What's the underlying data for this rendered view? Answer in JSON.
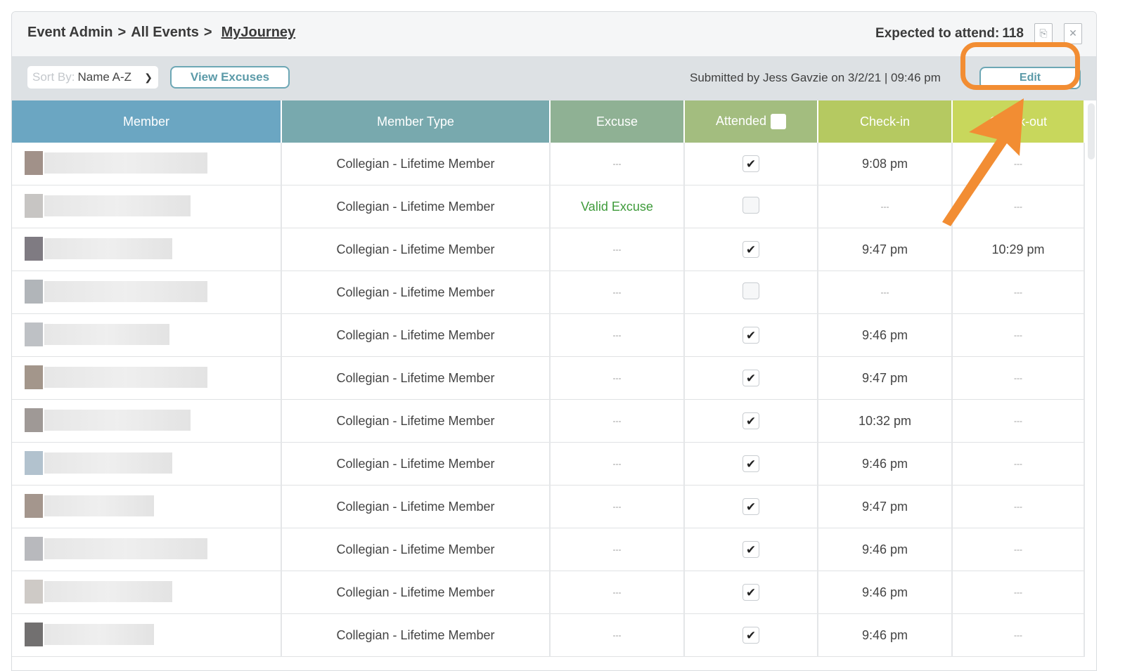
{
  "breadcrumb": [
    "Event Admin",
    "All Events",
    "MyJourney"
  ],
  "expected": {
    "label": "Expected to attend:",
    "count": "118"
  },
  "icons": {
    "pdf": "pdf-icon",
    "excel": "excel-icon"
  },
  "toolbar": {
    "sort_label": "Sort By:",
    "sort_value": "Name A-Z",
    "view_excuses": "View Excuses",
    "submitted": "Submitted by Jess Gavzie on 3/2/21  |  09:46 pm",
    "edit": "Edit"
  },
  "columns": [
    "Member",
    "Member Type",
    "Excuse",
    "Attended",
    "Check-in",
    "Check-out"
  ],
  "rows": [
    {
      "type": "Collegian - Lifetime Member",
      "excuse": "---",
      "attended": true,
      "checkin": "9:08 pm",
      "checkout": "---"
    },
    {
      "type": "Collegian - Lifetime Member",
      "excuse": "Valid Excuse",
      "attended": false,
      "checkin": "---",
      "checkout": "---"
    },
    {
      "type": "Collegian - Lifetime Member",
      "excuse": "---",
      "attended": true,
      "checkin": "9:47 pm",
      "checkout": "10:29 pm"
    },
    {
      "type": "Collegian - Lifetime Member",
      "excuse": "---",
      "attended": false,
      "checkin": "---",
      "checkout": "---"
    },
    {
      "type": "Collegian - Lifetime Member",
      "excuse": "---",
      "attended": true,
      "checkin": "9:46 pm",
      "checkout": "---"
    },
    {
      "type": "Collegian - Lifetime Member",
      "excuse": "---",
      "attended": true,
      "checkin": "9:47 pm",
      "checkout": "---"
    },
    {
      "type": "Collegian - Lifetime Member",
      "excuse": "---",
      "attended": true,
      "checkin": "10:32 pm",
      "checkout": "---"
    },
    {
      "type": "Collegian - Lifetime Member",
      "excuse": "---",
      "attended": true,
      "checkin": "9:46 pm",
      "checkout": "---"
    },
    {
      "type": "Collegian - Lifetime Member",
      "excuse": "---",
      "attended": true,
      "checkin": "9:47 pm",
      "checkout": "---"
    },
    {
      "type": "Collegian - Lifetime Member",
      "excuse": "---",
      "attended": true,
      "checkin": "9:46 pm",
      "checkout": "---"
    },
    {
      "type": "Collegian - Lifetime Member",
      "excuse": "---",
      "attended": true,
      "checkin": "9:46 pm",
      "checkout": "---"
    },
    {
      "type": "Collegian - Lifetime Member",
      "excuse": "---",
      "attended": true,
      "checkin": "9:46 pm",
      "checkout": "---"
    }
  ],
  "colors": {
    "highlight": "#f28d33",
    "accent": "#6da7b5",
    "valid": "#3f9b3b"
  }
}
